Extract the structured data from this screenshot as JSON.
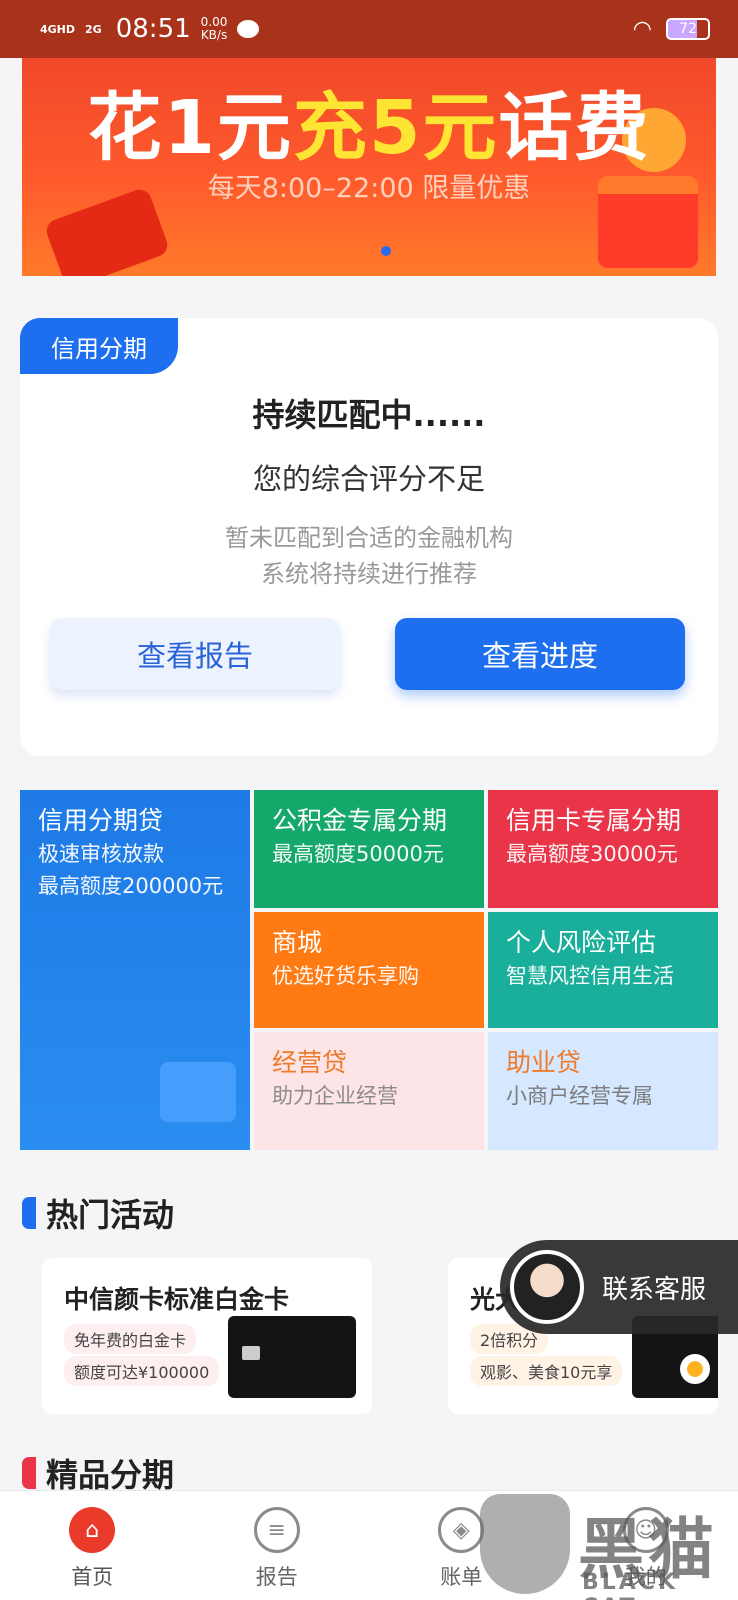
{
  "status_bar": {
    "signal1": "4GHD",
    "signal2": "2G",
    "time": "08:51",
    "speed_value": "0.00",
    "speed_unit": "KB/s",
    "battery": "72"
  },
  "banner": {
    "title_part1": "花1元",
    "title_part2": "充5元",
    "title_part3": "话费",
    "subtitle": "每天8:00–22:00 限量优惠"
  },
  "credit": {
    "tag": "信用分期",
    "status_title": "持续匹配中......",
    "score_msg": "您的综合评分不足",
    "hint_line1": "暂未匹配到合适的金融机构",
    "hint_line2": "系统将持续进行推荐",
    "report_button": "查看报告",
    "progress_button": "查看进度"
  },
  "products": {
    "big": {
      "title": "信用分期贷",
      "sub1": "极速审核放款",
      "sub2": "最高额度200000元"
    },
    "gjj": {
      "title": "公积金专属分期",
      "sub": "最高额度50000元"
    },
    "xyk": {
      "title": "信用卡专属分期",
      "sub": "最高额度30000元"
    },
    "mall": {
      "title": "商城",
      "sub": "优选好货乐享购"
    },
    "risk": {
      "title": "个人风险评估",
      "sub": "智慧风控信用生活"
    },
    "jyd": {
      "title": "经营贷",
      "sub": "助力企业经营"
    },
    "zyd": {
      "title": "助业贷",
      "sub": "小商户经营专属"
    }
  },
  "hot": {
    "title": "热门活动",
    "cards": [
      {
        "title": "中信颜卡标准白金卡",
        "pill1": "免年费的白金卡",
        "pill2": "额度可达¥100000"
      },
      {
        "title": "光大",
        "pill1": "2倍积分",
        "pill2": "观影、美食10元享"
      }
    ]
  },
  "customer_service": {
    "label": "联系客服"
  },
  "premium": {
    "title": "精品分期"
  },
  "tabs": [
    {
      "label": "首页",
      "icon": "home-icon",
      "glyph": "⌂"
    },
    {
      "label": "报告",
      "icon": "report-icon",
      "glyph": "≡"
    },
    {
      "label": "账单",
      "icon": "bill-icon",
      "glyph": "◈"
    },
    {
      "label": "我的",
      "icon": "profile-icon",
      "glyph": "☺"
    }
  ],
  "watermark": {
    "text": "黑猫",
    "sub": "BLACK CAT"
  },
  "colors": {
    "accent": "#1e6ef0",
    "red": "#ea3447",
    "green": "#14a86a",
    "orange": "#ff7a12",
    "teal": "#1aaf9a"
  }
}
